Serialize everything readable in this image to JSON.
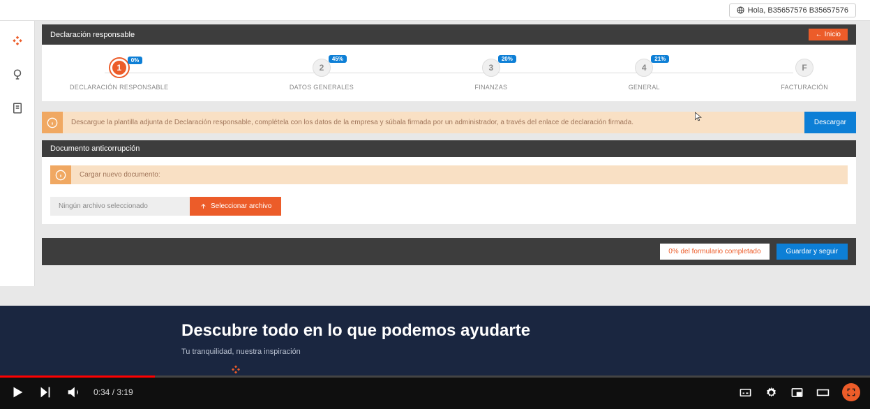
{
  "greeting": {
    "text": "Hola, B35657576 B35657576"
  },
  "section1": {
    "title": "Declaración responsable",
    "inicio_label": "Inicio"
  },
  "steps": [
    {
      "num": "1",
      "badge": "0%",
      "label": "DECLARACIÓN RESPONSABLE",
      "active": true
    },
    {
      "num": "2",
      "badge": "45%",
      "label": "DATOS GENERALES",
      "active": false
    },
    {
      "num": "3",
      "badge": "20%",
      "label": "FINANZAS",
      "active": false
    },
    {
      "num": "4",
      "badge": "21%",
      "label": "GENERAL",
      "active": false
    },
    {
      "num": "F",
      "badge": "",
      "label": "FACTURACIÓN",
      "active": false
    }
  ],
  "info": {
    "text": "Descargue la plantilla adjunta de Declaración responsable, complétela con los datos de la empresa y súbala firmada por un administrador, a través del enlace de declaración firmada.",
    "descargar_label": "Descargar"
  },
  "section2": {
    "title": "Documento anticorrupción",
    "upload_text": "Cargar nuevo documento:",
    "file_placeholder": "Ningún archivo seleccionado",
    "select_file_label": "Seleccionar archivo"
  },
  "footer": {
    "completion": "0% del formulario completado",
    "guardar_label": "Guardar y seguir"
  },
  "hero": {
    "title": "Descubre todo en lo que podemos ayudarte",
    "subtitle": "Tu tranquilidad, nuestra inspiración"
  },
  "video": {
    "current": "0:34",
    "total": "3:19"
  }
}
